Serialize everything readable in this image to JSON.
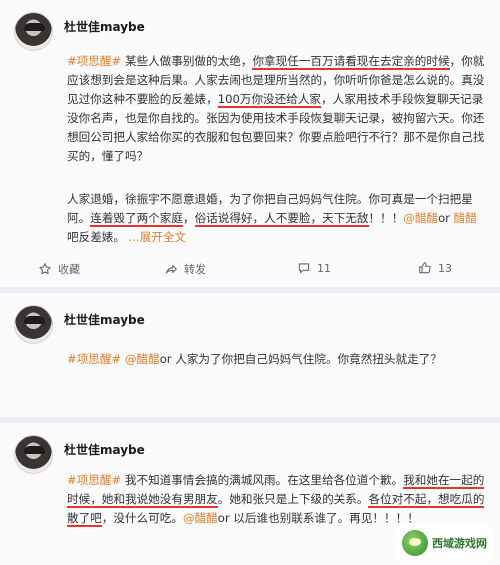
{
  "posts": [
    {
      "username": "杜世佳maybe",
      "p1": [
        {
          "t": "#项思醒#",
          "k": "link"
        },
        {
          "t": " 某些人做事别做的太绝，",
          "k": "txt"
        },
        {
          "t": "你拿现任一百万请看现在去定亲的时候",
          "k": "u"
        },
        {
          "t": "，你就应该想到会是这种后果。人家去闹也是理所当然的，你听听你爸是怎么说的。真没见过你这种不要脸的反差婊，",
          "k": "txt"
        },
        {
          "t": "100万你没还给人家",
          "k": "u"
        },
        {
          "t": "，人家用技术手段恢复聊天记录没你名声，也是你自找的。张因为使用技术手段恢复聊天记录，被拘留六天。你还想回公司把人家给你买的衣服和包包要回来？你要点脸吧行不行？那不是你自己找买的，懂了吗？",
          "k": "txt"
        }
      ],
      "p2": [
        {
          "t": "人家退婚，徐振宇不愿意退婚，为了你把自己妈妈气住院。你可真是一个扫把星阿。",
          "k": "txt"
        },
        {
          "t": "连着毁了两个家庭",
          "k": "u"
        },
        {
          "t": "，",
          "k": "txt"
        },
        {
          "t": "俗话说得好，人不要脸，天下无敌",
          "k": "u"
        },
        {
          "t": "！！！",
          "k": "txt"
        },
        {
          "t": "@醋醋",
          "k": "link"
        },
        {
          "t": "or ",
          "k": "txt"
        },
        {
          "t": "醋醋",
          "k": "link"
        },
        {
          "t": " 吧反差婊。",
          "k": "txt"
        },
        {
          "t": " ...展开全文",
          "k": "expand"
        }
      ],
      "actions": {
        "fav": "收藏",
        "share": "转发",
        "comment": "11",
        "like": "13"
      }
    },
    {
      "username": "杜世佳maybe",
      "p1": [
        {
          "t": "#项思醒#",
          "k": "link"
        },
        {
          "t": " ",
          "k": "txt"
        },
        {
          "t": "@醋醋",
          "k": "link"
        },
        {
          "t": "or 人家为了你把自己妈妈气住院。你竟然扭头就走了？",
          "k": "txt"
        }
      ]
    },
    {
      "username": "杜世佳maybe",
      "p1": [
        {
          "t": "#项思醒#",
          "k": "link"
        },
        {
          "t": " 我不知道事情会搞的满城风雨。在这里给各位道个歉。",
          "k": "txt"
        },
        {
          "t": "我和她在一起的时候，她和我说她没有男朋友",
          "k": "u"
        },
        {
          "t": "。她和张只是上下级的关系。",
          "k": "txt"
        },
        {
          "t": "各位对不起，想吃瓜的散了吧",
          "k": "u"
        },
        {
          "t": "，没什么可吃。",
          "k": "txt"
        },
        {
          "t": "@醋醋",
          "k": "link"
        },
        {
          "t": "or 以后谁也别联系谁了。再见！！！！",
          "k": "txt"
        }
      ]
    }
  ],
  "watermark": {
    "text": "西域游戏网"
  },
  "colors": {
    "link": "#e07f2a",
    "underline": "#e8342c",
    "card": "#fbfafc",
    "separator": "#ececf0"
  },
  "icons": {
    "fav": "star-icon",
    "share": "share-icon",
    "comment": "comment-icon",
    "like": "thumbs-up-icon"
  }
}
